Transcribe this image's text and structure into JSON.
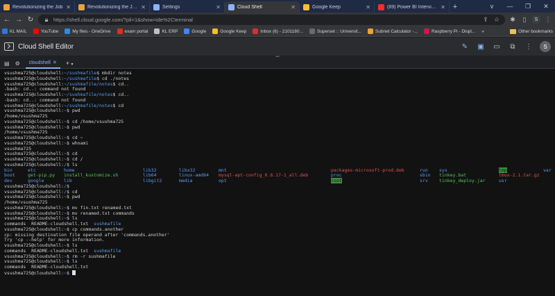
{
  "browser": {
    "tabs": [
      {
        "title": "Revolutionizing the Job",
        "favicon_color": "#e8a33a",
        "active": false
      },
      {
        "title": "Revolutionizing the Job Ma",
        "favicon_color": "#e8a33a",
        "active": false
      },
      {
        "title": "Settings",
        "favicon_color": "#8ab4f8",
        "active": false
      },
      {
        "title": "Cloud Shell",
        "favicon_color": "#8ab4f8",
        "active": true
      },
      {
        "title": "Google Keep",
        "favicon_color": "#f6c026",
        "active": false
      },
      {
        "title": "(69) Power BI Interview Qu",
        "favicon_color": "#ff2a2a",
        "active": false
      }
    ],
    "new_tab_label": "+",
    "window_controls": [
      "v",
      "—",
      "❐",
      "✕"
    ],
    "url": "https://shell.cloud.google.com/?pli=1&show=ide%2Cterminal",
    "profile_letter": "S"
  },
  "bookmarks": {
    "items": [
      {
        "label": "KL MAIL",
        "color": "#2f78d6"
      },
      {
        "label": "YouTube",
        "color": "#ff0000"
      },
      {
        "label": "My files - OneDrive",
        "color": "#2a8be8"
      },
      {
        "label": "exam portal",
        "color": "#d93025"
      },
      {
        "label": "KL ERP",
        "color": "#c0c0c0"
      },
      {
        "label": "Google",
        "color": "#4285f4"
      },
      {
        "label": "Google Keep",
        "color": "#f6c026"
      },
      {
        "label": "Inbox (6) - 2101180...",
        "color": "#d93025"
      },
      {
        "label": "Superset :: Universit...",
        "color": "#6a6a6a"
      },
      {
        "label": "Subnet Calculator -...",
        "color": "#e8a33a"
      },
      {
        "label": "Raspberry Pi - Displ...",
        "color": "#c51a4a"
      }
    ],
    "more": "»",
    "other_label": "Other bookmarks"
  },
  "editor": {
    "title": "Cloud Shell Editor",
    "avatar_letter": "S",
    "terminal_tab": "cloudshell",
    "add_label": "+"
  },
  "terminal": {
    "prompt_user": "vsushma725@cloudshell:",
    "lines": [
      {
        "path": "~/sushmafile",
        "cmd": "mkdir notes"
      },
      {
        "path": "~/sushmafile",
        "cmd": "cd ./notes"
      },
      {
        "path": "~/sushmafile/notes",
        "cmd": "cd.."
      },
      {
        "out": "-bash: cd..: command not found"
      },
      {
        "path": "~/sushmafile/notes",
        "cmd": "cd.."
      },
      {
        "out": "-bash: cd..: command not found"
      },
      {
        "path": "~/sushmafile/notes",
        "cmd": "cd"
      },
      {
        "path": "~",
        "cmd": "pwd"
      },
      {
        "out": "/home/vsushma725"
      },
      {
        "path": "~",
        "cmd": "cd /home/vsushma725"
      },
      {
        "path": "~",
        "cmd": "pwd"
      },
      {
        "out": "/home/vsushma725"
      },
      {
        "path": "~",
        "cmd": "cd ~"
      },
      {
        "path": "~",
        "cmd": "whoami"
      },
      {
        "out": "vsushma725"
      },
      {
        "path": "~",
        "cmd": "cd"
      },
      {
        "path": "~",
        "cmd": "cd /"
      },
      {
        "path": "/",
        "cmd": "ls"
      }
    ],
    "ls_root": [
      [
        "bin",
        "etc",
        "home",
        "lib32",
        "libx32",
        "mnt",
        "packages-microsoft-prod.deb",
        "run",
        "sys",
        "tmp",
        "var"
      ],
      [
        "boot",
        "get-pip.py",
        "install_kustomize.sh",
        "lib64",
        "linux-amd64",
        "mysql-apt-config_0.8.17-1_all.deb",
        "proc",
        "sbin",
        "tinkey.bat",
        "tmux-2.1.tar.gz",
        ""
      ],
      [
        "dev",
        "google",
        "lib",
        "libgit2",
        "media",
        "opt",
        "root",
        "srv",
        "tinkey_deploy.jar",
        "usr",
        ""
      ]
    ],
    "lines2": [
      {
        "path": "/",
        "cmd": ""
      },
      {
        "path": "/",
        "cmd": "cd"
      },
      {
        "path": "~",
        "cmd": "pwd"
      },
      {
        "out": "/home/vsushma725"
      },
      {
        "path": "~",
        "cmd": "mv fin.txt renamed.txt"
      },
      {
        "path": "~",
        "cmd": "mv renamed.txt commands"
      },
      {
        "path": "~",
        "cmd": "ls"
      }
    ],
    "ls_home_1": [
      "commands",
      "README-cloudshell.txt",
      "sushmafile"
    ],
    "lines3": [
      {
        "path": "~",
        "cmd": "cp commands.another"
      },
      {
        "out": "cp: missing destination file operand after 'commands.another'"
      },
      {
        "out": "Try 'cp --help' for more information."
      },
      {
        "path": "~",
        "cmd": "ls"
      }
    ],
    "ls_home_2": [
      "commands",
      "README-cloudshell.txt",
      "sushmafile"
    ],
    "lines4": [
      {
        "path": "~",
        "cmd": "rm -r sushmafile"
      },
      {
        "path": "~",
        "cmd": "ls"
      }
    ],
    "ls_home_3": [
      "commands",
      "README-cloudshell.txt"
    ],
    "final_prompt_path": "~"
  }
}
